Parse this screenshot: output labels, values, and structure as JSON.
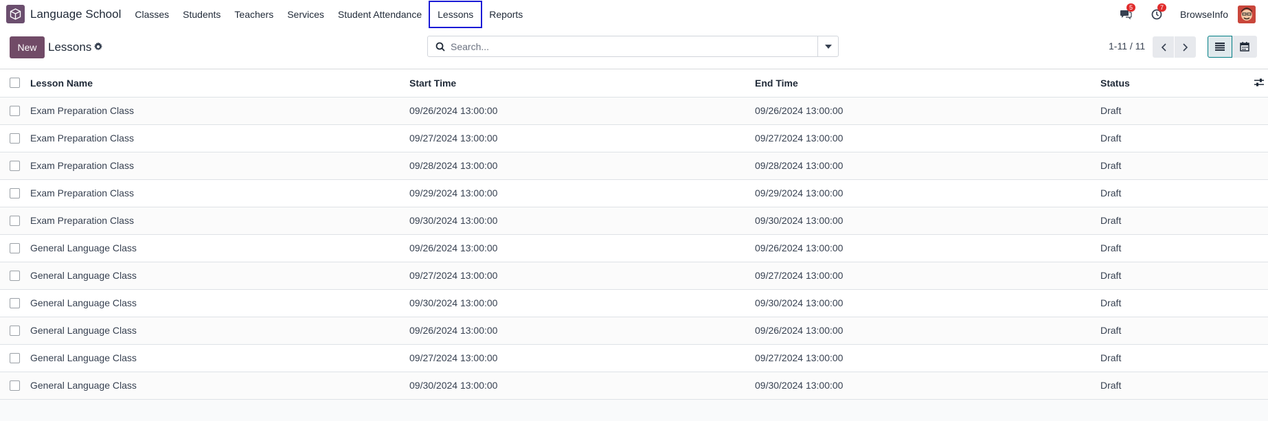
{
  "navbar": {
    "app_name": "Language School",
    "menu": [
      {
        "label": "Classes"
      },
      {
        "label": "Students"
      },
      {
        "label": "Teachers"
      },
      {
        "label": "Services"
      },
      {
        "label": "Student Attendance"
      },
      {
        "label": "Lessons",
        "active": true
      },
      {
        "label": "Reports"
      }
    ],
    "messages_count": "5",
    "activities_count": "7",
    "company": "BrowseInfo"
  },
  "control": {
    "new_label": "New",
    "title": "Lessons",
    "search_placeholder": "Search...",
    "pager": "1-11 / 11"
  },
  "table": {
    "headers": {
      "name": "Lesson Name",
      "start": "Start Time",
      "end": "End Time",
      "status": "Status"
    },
    "rows": [
      {
        "name": "Exam Preparation Class",
        "start": "09/26/2024 13:00:00",
        "end": "09/26/2024 13:00:00",
        "status": "Draft"
      },
      {
        "name": "Exam Preparation Class",
        "start": "09/27/2024 13:00:00",
        "end": "09/27/2024 13:00:00",
        "status": "Draft"
      },
      {
        "name": "Exam Preparation Class",
        "start": "09/28/2024 13:00:00",
        "end": "09/28/2024 13:00:00",
        "status": "Draft"
      },
      {
        "name": "Exam Preparation Class",
        "start": "09/29/2024 13:00:00",
        "end": "09/29/2024 13:00:00",
        "status": "Draft"
      },
      {
        "name": "Exam Preparation Class",
        "start": "09/30/2024 13:00:00",
        "end": "09/30/2024 13:00:00",
        "status": "Draft"
      },
      {
        "name": "General Language Class",
        "start": "09/26/2024 13:00:00",
        "end": "09/26/2024 13:00:00",
        "status": "Draft"
      },
      {
        "name": "General Language Class",
        "start": "09/27/2024 13:00:00",
        "end": "09/27/2024 13:00:00",
        "status": "Draft"
      },
      {
        "name": "General Language Class",
        "start": "09/30/2024 13:00:00",
        "end": "09/30/2024 13:00:00",
        "status": "Draft"
      },
      {
        "name": "General Language Class",
        "start": "09/26/2024 13:00:00",
        "end": "09/26/2024 13:00:00",
        "status": "Draft"
      },
      {
        "name": "General Language Class",
        "start": "09/27/2024 13:00:00",
        "end": "09/27/2024 13:00:00",
        "status": "Draft"
      },
      {
        "name": "General Language Class",
        "start": "09/30/2024 13:00:00",
        "end": "09/30/2024 13:00:00",
        "status": "Draft"
      }
    ]
  },
  "colors": {
    "brand": "#714b67",
    "active_outline": "#1a1ad6",
    "badge": "#e02b2b",
    "view_active": "#017e84"
  }
}
